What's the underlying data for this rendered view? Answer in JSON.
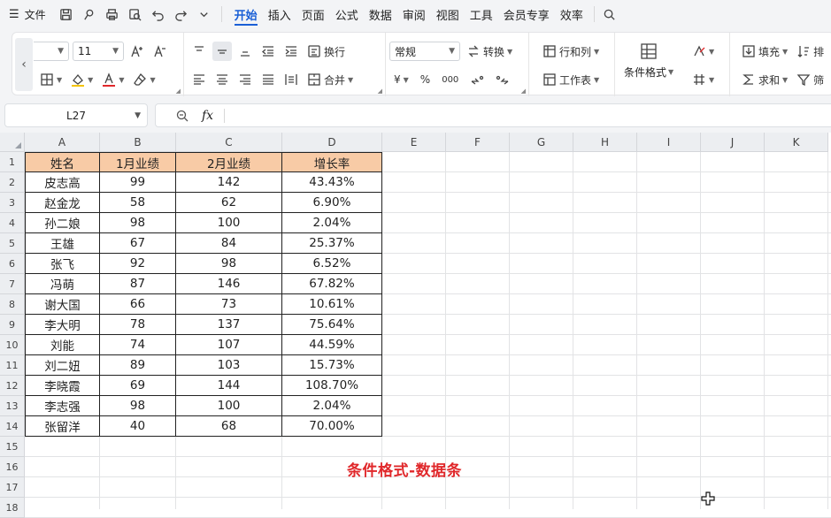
{
  "menubar": {
    "file_label": "文件",
    "tabs": [
      {
        "label": "开始",
        "active": true
      },
      {
        "label": "插入"
      },
      {
        "label": "页面"
      },
      {
        "label": "公式"
      },
      {
        "label": "数据"
      },
      {
        "label": "审阅"
      },
      {
        "label": "视图"
      },
      {
        "label": "工具"
      },
      {
        "label": "会员专享"
      },
      {
        "label": "效率"
      }
    ]
  },
  "ribbon": {
    "font_size": "11",
    "wrap_label": "换行",
    "merge_label": "合并",
    "number_format": "常规",
    "convert_label": "转换",
    "rowcol_label": "行和列",
    "sheet_label": "工作表",
    "condformat_label": "条件格式",
    "fill_label": "填充",
    "sum_label": "求和",
    "sort_label": "排",
    "filter_label": "筛",
    "currency_symbol": "¥",
    "percent_symbol": "%",
    "thousands_symbol": "000"
  },
  "formula_bar": {
    "cell_ref": "L27",
    "fx_label": "fx",
    "value": ""
  },
  "sheet": {
    "columns": [
      "A",
      "B",
      "C",
      "D",
      "E",
      "F",
      "G",
      "H",
      "I",
      "J",
      "K"
    ],
    "rows": [
      "1",
      "2",
      "3",
      "4",
      "5",
      "6",
      "7",
      "8",
      "9",
      "10",
      "11",
      "12",
      "13",
      "14",
      "15",
      "16",
      "17",
      "18"
    ],
    "header": [
      "姓名",
      "1月业绩",
      "2月业绩",
      "增长率"
    ],
    "data": [
      [
        "皮志高",
        "99",
        "142",
        "43.43%"
      ],
      [
        "赵金龙",
        "58",
        "62",
        "6.90%"
      ],
      [
        "孙二娘",
        "98",
        "100",
        "2.04%"
      ],
      [
        "王雄",
        "67",
        "84",
        "25.37%"
      ],
      [
        "张飞",
        "92",
        "98",
        "6.52%"
      ],
      [
        "冯萌",
        "87",
        "146",
        "67.82%"
      ],
      [
        "谢大国",
        "66",
        "73",
        "10.61%"
      ],
      [
        "李大明",
        "78",
        "137",
        "75.64%"
      ],
      [
        "刘能",
        "74",
        "107",
        "44.59%"
      ],
      [
        "刘二妞",
        "89",
        "103",
        "15.73%"
      ],
      [
        "李晓霞",
        "69",
        "144",
        "108.70%"
      ],
      [
        "李志强",
        "98",
        "100",
        "2.04%"
      ],
      [
        "张留洋",
        "40",
        "68",
        "70.00%"
      ]
    ],
    "header_fill": "#f8cba6"
  },
  "caption": {
    "text": "条件格式-数据条",
    "color": "#e0282b"
  },
  "colors": {
    "accent": "#1a5fd6",
    "chrome": "#f3f4f6"
  }
}
